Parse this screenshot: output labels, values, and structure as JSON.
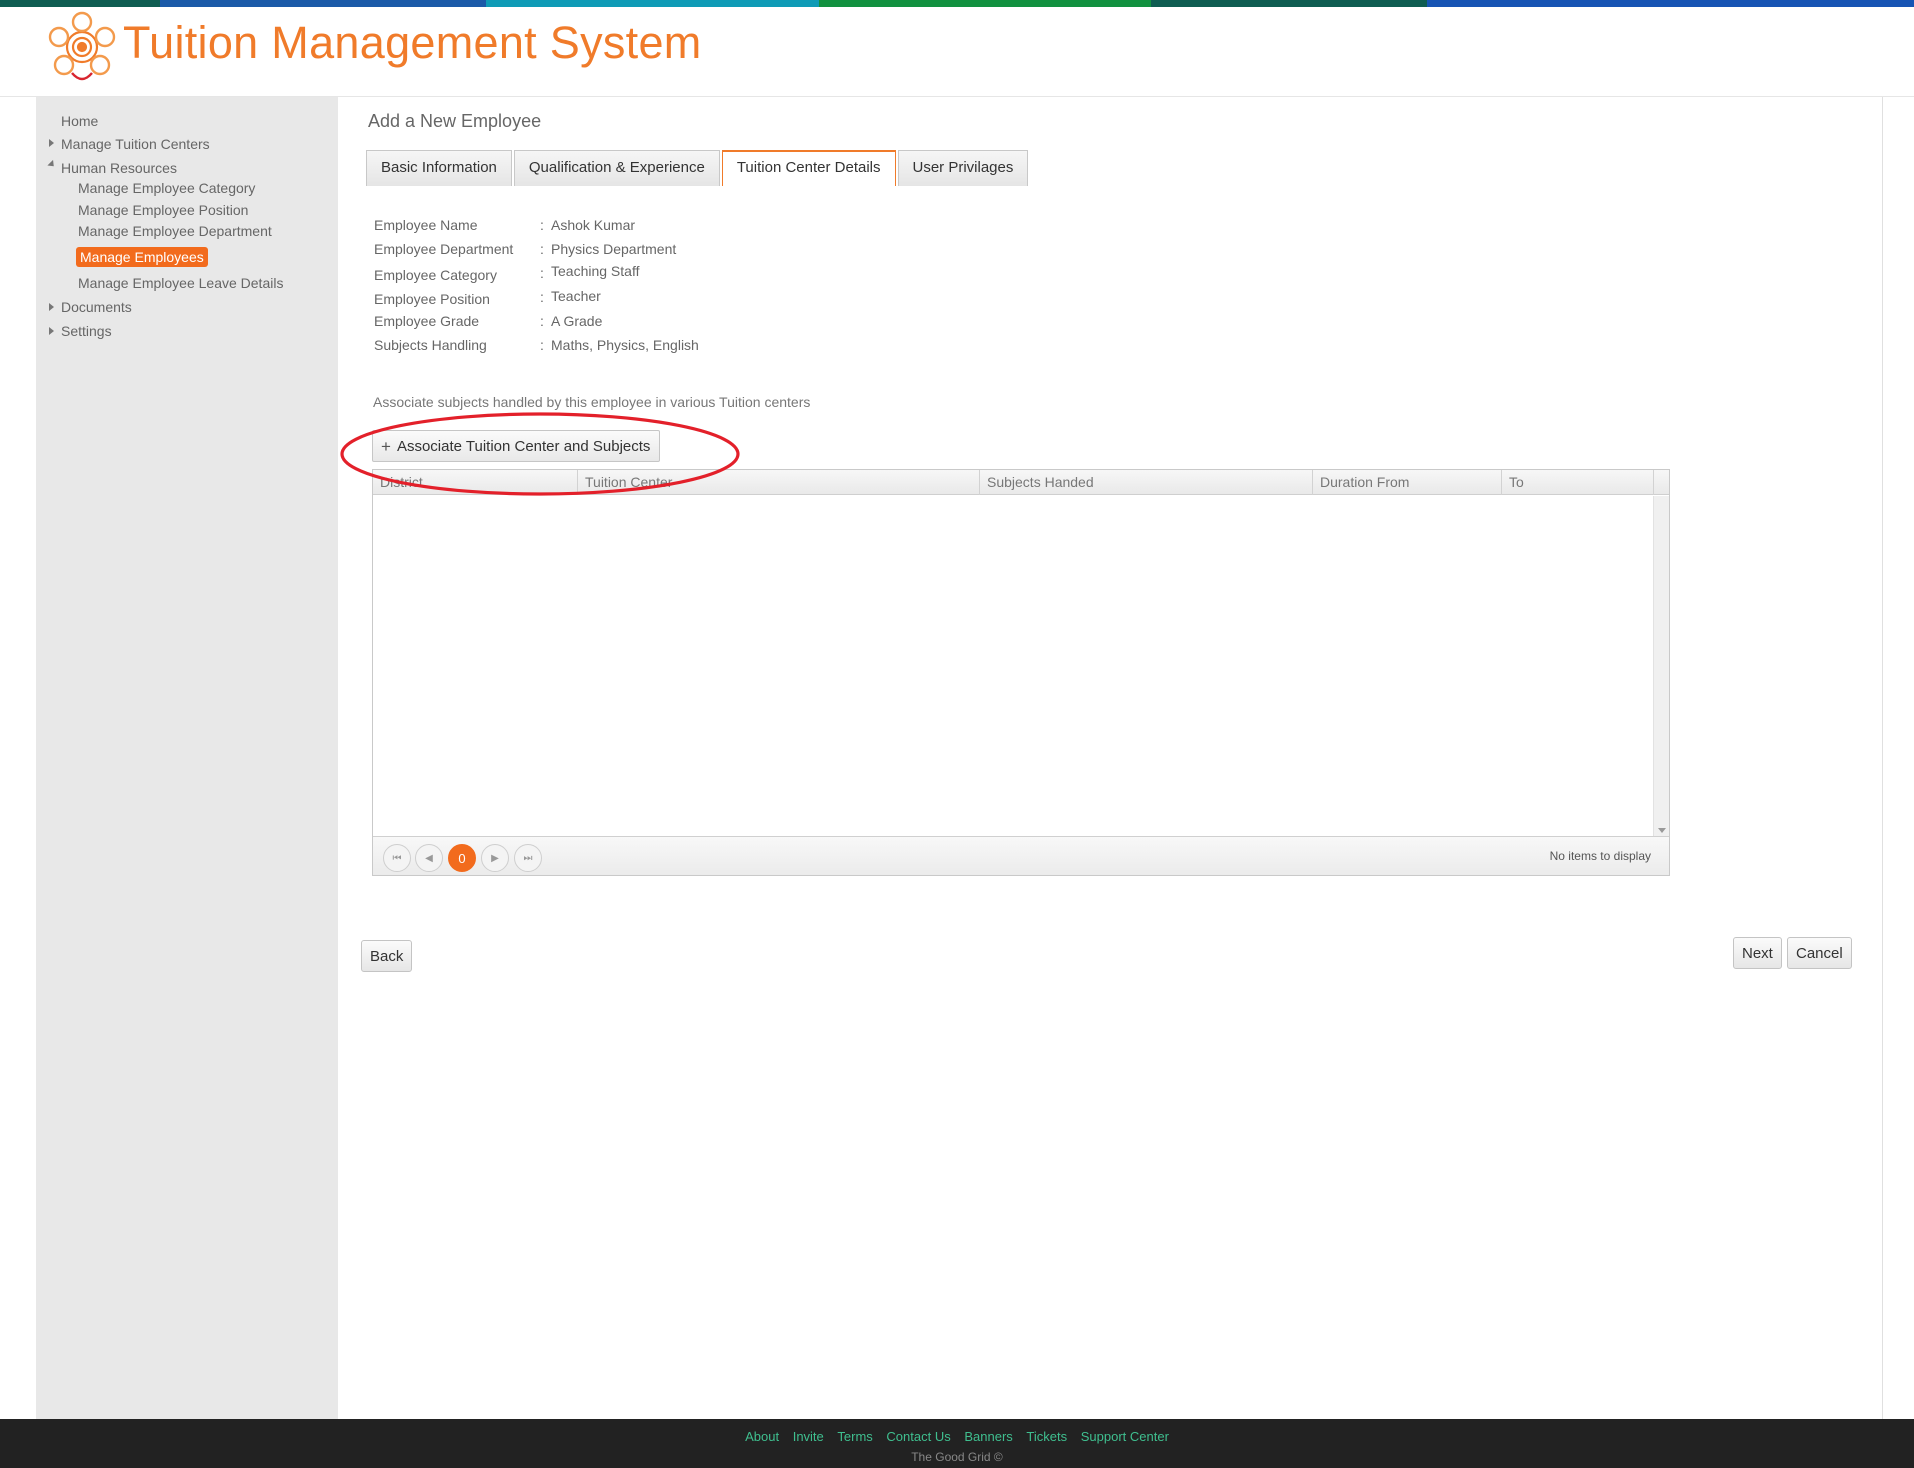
{
  "app": {
    "title": "Tuition Management System"
  },
  "colors": {
    "accent": "#f26b1d",
    "title": "#f07b2a",
    "strip": [
      "#0f5d52",
      "#1b5aa8",
      "#0e9bb6",
      "#11913f",
      "#0f5d52",
      "#1654b4"
    ],
    "highlight": "#e3202a",
    "footer_link": "#3fbf8f"
  },
  "sidebar": {
    "home": "Home",
    "manage_tuition_centers": "Manage Tuition Centers",
    "human_resources": "Human Resources",
    "hr_items": [
      "Manage Employee Category",
      "Manage Employee Position",
      "Manage Employee Department",
      "Manage Employees",
      "Manage Employee Leave Details"
    ],
    "documents": "Documents",
    "settings": "Settings"
  },
  "main": {
    "page_title": "Add a New Employee",
    "tabs": [
      {
        "label": "Basic Information"
      },
      {
        "label": "Qualification & Experience"
      },
      {
        "label": "Tuition Center Details"
      },
      {
        "label": "User Privilages"
      }
    ],
    "info": [
      {
        "label": "Employee Name",
        "value": "Ashok Kumar"
      },
      {
        "label": "Employee Department",
        "value": "Physics Department"
      },
      {
        "label": "Employee Category",
        "value": "Teaching Staff"
      },
      {
        "label": "Employee Position",
        "value": "Teacher"
      },
      {
        "label": "Employee Grade",
        "value": "A Grade"
      },
      {
        "label": "Subjects Handling",
        "value": "Maths, Physics, English"
      }
    ],
    "colon": ":",
    "associate_note": "Associate subjects handled by this employee in various Tuition centers",
    "associate_button": "Associate Tuition Center and Subjects",
    "plus_glyph": "+",
    "grid": {
      "columns": [
        "District",
        "Tuition Center",
        "Subjects Handed",
        "Duration From",
        "To"
      ],
      "current_page": "0",
      "status": "No items to display"
    },
    "back": "Back",
    "next": "Next",
    "cancel": "Cancel"
  },
  "footer": {
    "links": [
      "About",
      "Invite",
      "Terms",
      "Contact Us",
      "Banners",
      "Tickets",
      "Support Center"
    ],
    "copyright": "The Good Grid ©"
  }
}
